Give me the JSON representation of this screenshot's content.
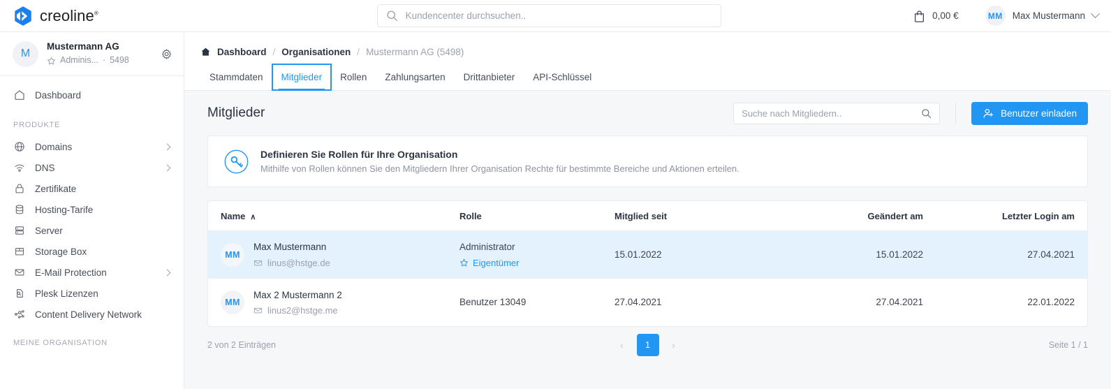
{
  "brand": {
    "name": "creoline",
    "trademark": "®"
  },
  "topbar": {
    "search_placeholder": "Kundencenter durchsuchen..",
    "cart_amount": "0,00 €",
    "user_initials": "MM",
    "user_name": "Max Mustermann"
  },
  "org": {
    "initial": "M",
    "name": "Mustermann AG",
    "role_short": "Adminis...",
    "separator": "·",
    "id": "5498"
  },
  "sidebar": {
    "dashboard": {
      "label": "Dashboard",
      "icon": "home-icon"
    },
    "section_products": "PRODUKTE",
    "products": [
      {
        "label": "Domains",
        "icon": "globe-icon",
        "expandable": true
      },
      {
        "label": "DNS",
        "icon": "wifi-icon",
        "expandable": true
      },
      {
        "label": "Zertifikate",
        "icon": "lock-icon",
        "expandable": false
      },
      {
        "label": "Hosting-Tarife",
        "icon": "database-icon",
        "expandable": false
      },
      {
        "label": "Server",
        "icon": "server-icon",
        "expandable": false
      },
      {
        "label": "Storage Box",
        "icon": "box-icon",
        "expandable": false
      },
      {
        "label": "E-Mail Protection",
        "icon": "envelope-icon",
        "expandable": true
      },
      {
        "label": "Plesk Lizenzen",
        "icon": "license-icon",
        "expandable": false
      },
      {
        "label": "Content Delivery Network",
        "icon": "network-icon",
        "expandable": false
      }
    ],
    "section_org": "MEINE ORGANISATION"
  },
  "breadcrumb": {
    "home_icon": "home-icon",
    "item1": "Dashboard",
    "sep1": "/",
    "item2": "Organisationen",
    "sep2": "/",
    "current": "Mustermann AG (5498)"
  },
  "tabs": [
    {
      "label": "Stammdaten",
      "active": false
    },
    {
      "label": "Mitglieder",
      "active": true
    },
    {
      "label": "Rollen",
      "active": false
    },
    {
      "label": "Zahlungsarten",
      "active": false
    },
    {
      "label": "Drittanbieter",
      "active": false
    },
    {
      "label": "API-Schlüssel",
      "active": false
    }
  ],
  "page": {
    "title": "Mitglieder",
    "search_placeholder": "Suche nach Mitgliedern..",
    "invite_button": "Benutzer einladen"
  },
  "banner": {
    "icon": "key-icon",
    "title": "Definieren Sie Rollen für Ihre Organisation",
    "description": "Mithilfe von Rollen können Sie den Mitgliedern Ihrer Organisation Rechte für bestimmte Bereiche und Aktionen erteilen."
  },
  "table": {
    "columns": {
      "name": "Name",
      "sort_caret": "∧",
      "role": "Rolle",
      "member_since": "Mitglied seit",
      "changed": "Geändert am",
      "last_login": "Letzter Login am"
    },
    "rows": [
      {
        "initials": "MM",
        "name": "Max Mustermann",
        "email": "linus@hstge.de",
        "role": "Administrator",
        "owner_badge": "Eigentümer",
        "member_since": "15.01.2022",
        "changed": "15.01.2022",
        "last_login": "27.04.2021",
        "selected": true
      },
      {
        "initials": "MM",
        "name": "Max 2 Mustermann 2",
        "email": "linus2@hstge.me",
        "role": "Benutzer 13049",
        "owner_badge": "",
        "member_since": "27.04.2021",
        "changed": "27.04.2021",
        "last_login": "22.01.2022",
        "selected": false
      }
    ]
  },
  "pagination": {
    "entries": "2 von 2 Einträgen",
    "prev": "‹",
    "page": "1",
    "next": "›",
    "page_info": "Seite 1 / 1"
  },
  "colors": {
    "accent": "#2196f3",
    "selected_row": "#e3f2fd",
    "content_bg": "#f6f7f9",
    "border": "#e8ebef"
  }
}
